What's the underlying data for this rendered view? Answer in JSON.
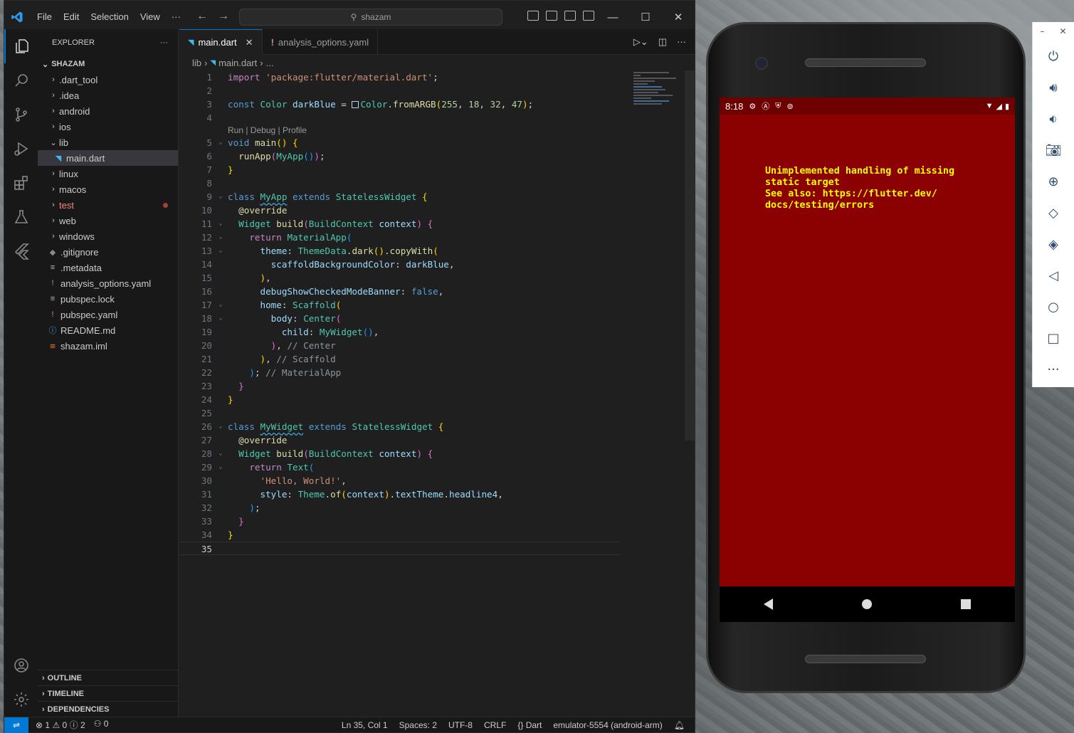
{
  "vscode": {
    "menu": [
      "File",
      "Edit",
      "Selection",
      "View",
      "···"
    ],
    "search": "shazam",
    "explorer": {
      "title": "EXPLORER",
      "more": "···",
      "root": "SHAZAM",
      "items": [
        {
          "label": ".dart_tool",
          "type": "folder",
          "open": false,
          "indent": 1
        },
        {
          "label": ".idea",
          "type": "folder",
          "open": false,
          "indent": 1
        },
        {
          "label": "android",
          "type": "folder",
          "open": false,
          "indent": 1
        },
        {
          "label": "ios",
          "type": "folder",
          "open": false,
          "indent": 1
        },
        {
          "label": "lib",
          "type": "folder",
          "open": true,
          "indent": 1
        },
        {
          "label": "main.dart",
          "type": "dart",
          "indent": 2,
          "selected": true
        },
        {
          "label": "linux",
          "type": "folder",
          "open": false,
          "indent": 1
        },
        {
          "label": "macos",
          "type": "folder",
          "open": false,
          "indent": 1
        },
        {
          "label": "test",
          "type": "folder",
          "open": false,
          "indent": 1,
          "error": true
        },
        {
          "label": "web",
          "type": "folder",
          "open": false,
          "indent": 1
        },
        {
          "label": "windows",
          "type": "folder",
          "open": false,
          "indent": 1
        },
        {
          "label": ".gitignore",
          "type": "git",
          "indent": 1
        },
        {
          "label": ".metadata",
          "type": "text",
          "indent": 1
        },
        {
          "label": "analysis_options.yaml",
          "type": "yaml",
          "indent": 1
        },
        {
          "label": "pubspec.lock",
          "type": "text",
          "indent": 1
        },
        {
          "label": "pubspec.yaml",
          "type": "yaml",
          "indent": 1
        },
        {
          "label": "README.md",
          "type": "info",
          "indent": 1
        },
        {
          "label": "shazam.iml",
          "type": "rss",
          "indent": 1
        }
      ],
      "sections": [
        "OUTLINE",
        "TIMELINE",
        "DEPENDENCIES"
      ]
    },
    "tabs": [
      {
        "label": "main.dart",
        "active": true
      },
      {
        "label": "analysis_options.yaml",
        "active": false
      }
    ],
    "breadcrumb": [
      "lib",
      "main.dart",
      "..."
    ],
    "code_lens": "Run | Debug | Profile",
    "current_line": 35,
    "status": {
      "errors": "1",
      "warnings": "0",
      "infos": "2",
      "ports": "0",
      "position": "Ln 35, Col 1",
      "spaces": "Spaces: 2",
      "encoding": "UTF-8",
      "eol": "CRLF",
      "language": "Dart",
      "device": "emulator-5554 (android-arm)"
    }
  },
  "emulator": {
    "time": "8:18",
    "error_text": "Unimplemented handling of missing\nstatic target\nSee also: https://flutter.dev/\ndocs/testing/errors",
    "colors": {
      "screen": "#8b0000",
      "text": "#ffff00"
    },
    "toolbar": [
      "power-icon",
      "volume-up-icon",
      "volume-down-icon",
      "camera-icon",
      "zoom-icon",
      "rotate-left-icon",
      "rotate-right-icon",
      "back-icon",
      "home-icon",
      "overview-icon",
      "more-icon"
    ]
  }
}
